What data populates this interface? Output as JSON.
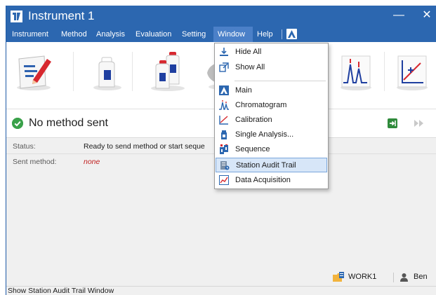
{
  "window": {
    "title": "Instrument 1",
    "minimize_glyph": "—",
    "close_glyph": "✕"
  },
  "menubar": {
    "items": [
      {
        "label": "Instrument"
      },
      {
        "label": "Method"
      },
      {
        "label": "Analysis"
      },
      {
        "label": "Evaluation"
      },
      {
        "label": "Setting"
      },
      {
        "label": "Window"
      },
      {
        "label": "Help"
      }
    ],
    "active": "Window"
  },
  "toolbar": {
    "tools": [
      {
        "icon": "method-edit-icon"
      },
      {
        "icon": "single-bottle-icon"
      },
      {
        "icon": "bottles-sequence-icon"
      },
      {
        "icon": "partial-hidden-icon"
      },
      {
        "icon": "chromatogram-icon"
      },
      {
        "icon": "calibration-icon"
      }
    ]
  },
  "status": {
    "title": "No method sent",
    "rows": [
      {
        "label": "Status:",
        "value": "Ready to send method or start seque"
      },
      {
        "label": "Sent method:",
        "value": "none"
      }
    ]
  },
  "footer": {
    "workspace": "WORK1",
    "user": "Ben"
  },
  "statusbar": {
    "text": "Show Station Audit Trail Window"
  },
  "window_menu": {
    "items": [
      {
        "label": "Hide All",
        "icon": "hide-all-icon"
      },
      {
        "label": "Show All",
        "icon": "show-all-icon"
      },
      {
        "label": "Main",
        "icon": "main-icon"
      },
      {
        "label": "Chromatogram",
        "icon": "chromatogram-icon"
      },
      {
        "label": "Calibration",
        "icon": "calibration-icon"
      },
      {
        "label": "Single Analysis...",
        "icon": "single-analysis-icon"
      },
      {
        "label": "Sequence",
        "icon": "sequence-icon"
      },
      {
        "label": "Station Audit Trail",
        "icon": "audit-trail-icon"
      },
      {
        "label": "Data Acquisition",
        "icon": "data-acquisition-icon"
      }
    ],
    "highlighted": "Station Audit Trail"
  },
  "colors": {
    "title_bar": "#2c67b0",
    "menu_active": "#4b80c8",
    "ok_green": "#3aa14a",
    "warn_red": "#c02020",
    "highlight": "#d7e6f8"
  }
}
